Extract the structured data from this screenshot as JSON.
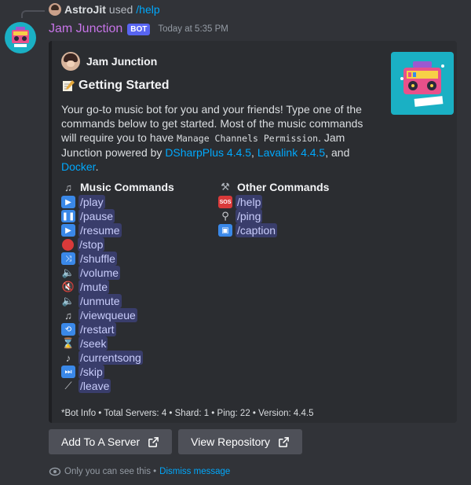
{
  "reply": {
    "user": "AstroJit",
    "used_text": "used",
    "command": "/help"
  },
  "message": {
    "bot_name": "Jam Junction",
    "bot_tag": "BOT",
    "timestamp": "Today at 5:35 PM"
  },
  "embed": {
    "author": "Jam Junction",
    "title": "Getting Started",
    "description": {
      "part1": "Your go-to music bot for you and your friends! Type one of the commands below to get started. Most of the music commands will require you to have ",
      "code": "Manage Channels Permission",
      "part2": ". Jam Junction powered by ",
      "link1": "DSharpPlus 4.4.5",
      "sep1": ", ",
      "link2": "Lavalink 4.4.5",
      "sep2": ", and ",
      "link3": "Docker",
      "end": "."
    },
    "music_heading": "Music Commands",
    "other_heading": "Other Commands",
    "music_commands": [
      {
        "icon": "play-icon",
        "label": "/play"
      },
      {
        "icon": "pause-icon",
        "label": "/pause"
      },
      {
        "icon": "play-icon",
        "label": "/resume"
      },
      {
        "icon": "stop-icon",
        "label": "/stop"
      },
      {
        "icon": "shuffle-icon",
        "label": "/shuffle"
      },
      {
        "icon": "speaker-icon",
        "label": "/volume"
      },
      {
        "icon": "mute-icon",
        "label": "/mute"
      },
      {
        "icon": "speaker-icon",
        "label": "/unmute"
      },
      {
        "icon": "notes-icon",
        "label": "/viewqueue"
      },
      {
        "icon": "repeat-icon",
        "label": "/restart"
      },
      {
        "icon": "hourglass-icon",
        "label": "/seek"
      },
      {
        "icon": "note-icon",
        "label": "/currentsong"
      },
      {
        "icon": "next-track-icon",
        "label": "/skip"
      },
      {
        "icon": "broom-icon",
        "label": "/leave"
      }
    ],
    "other_commands": [
      {
        "icon": "sos-icon",
        "label": "/help"
      },
      {
        "icon": "magnifier-icon",
        "label": "/ping"
      },
      {
        "icon": "picture-icon",
        "label": "/caption"
      }
    ],
    "footer": "*Bot Info • Total Servers: 4 • Shard: 1 • Ping: 22 • Version: 4.4.5"
  },
  "buttons": {
    "add_server": "Add To A Server",
    "view_repo": "View Repository"
  },
  "ephemeral": {
    "text": "Only you can see this •",
    "dismiss": "Dismiss message"
  }
}
